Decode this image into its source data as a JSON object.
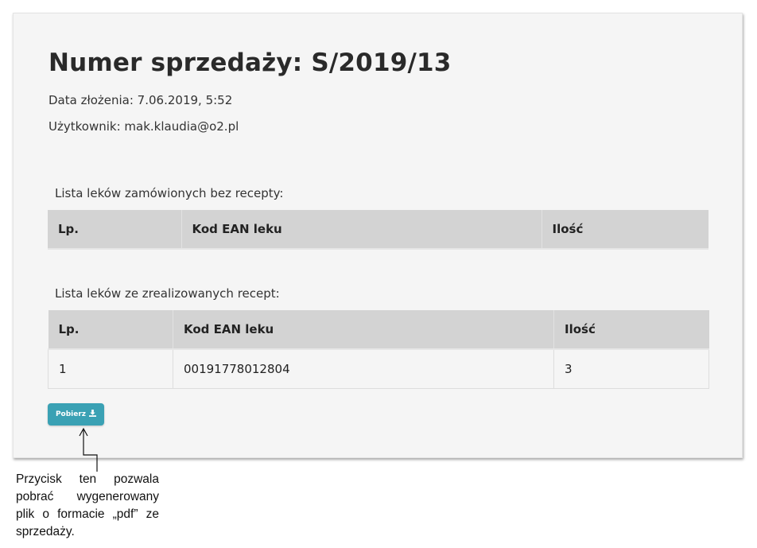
{
  "sale": {
    "title": "Numer sprzedaży: S/2019/13",
    "date": "Data złożenia: 7.06.2019, 5:52",
    "user": "Użytkownik: mak.klaudia@o2.pl"
  },
  "otc_section": {
    "label": "Lista leków zamówionych bez recepty:",
    "columns": [
      "Lp.",
      "Kod EAN leku",
      "Ilość"
    ],
    "rows": []
  },
  "rx_section": {
    "label": "Lista leków ze zrealizowanych recept:",
    "columns": [
      "Lp.",
      "Kod EAN leku",
      "Ilość"
    ],
    "rows": [
      [
        "1",
        "00191778012804",
        "3"
      ]
    ]
  },
  "download_button": {
    "label": "Pobierz",
    "icon": "download-icon",
    "color": "#3aa1b4"
  },
  "annotation": {
    "text": "Przycisk ten pozwala pobrać wygenerowany plik o formacie „pdf” ze sprzedaży."
  }
}
